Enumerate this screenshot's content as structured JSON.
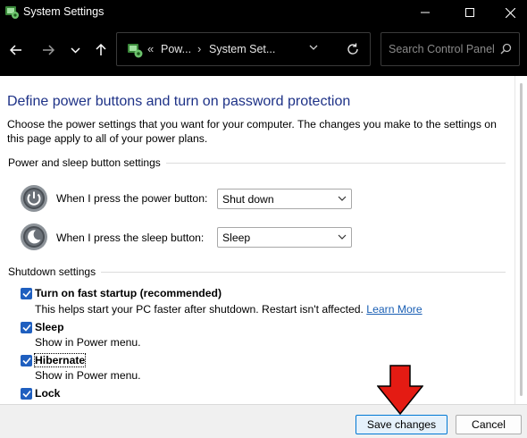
{
  "window": {
    "title": "System Settings",
    "controls": [
      "minimize-icon",
      "maximize-icon",
      "close-icon"
    ]
  },
  "nav": {
    "breadcrumb_overflow": "«",
    "breadcrumb": [
      "Pow...",
      "System Set..."
    ],
    "breadcrumb_separator": "›",
    "search_placeholder": "Search Control Panel"
  },
  "page": {
    "title": "Define power buttons and turn on password protection",
    "description": "Choose the power settings that you want for your computer. The changes you make to the settings on this page apply to all of your power plans."
  },
  "power_section": {
    "title": "Power and sleep button settings",
    "rows": [
      {
        "label": "When I press the power button:",
        "value": "Shut down",
        "icon": "power-icon"
      },
      {
        "label": "When I press the sleep button:",
        "value": "Sleep",
        "icon": "sleep-icon"
      }
    ]
  },
  "shutdown_section": {
    "title": "Shutdown settings",
    "items": [
      {
        "label": "Turn on fast startup (recommended)",
        "checked": true,
        "desc": "This helps start your PC faster after shutdown. Restart isn't affected.",
        "link": "Learn More"
      },
      {
        "label": "Sleep",
        "checked": true,
        "desc": "Show in Power menu."
      },
      {
        "label": "Hibernate",
        "checked": true,
        "desc": "Show in Power menu."
      },
      {
        "label": "Lock",
        "checked": true
      }
    ]
  },
  "footer": {
    "save_label": "Save changes",
    "cancel_label": "Cancel"
  },
  "colors": {
    "title_blue": "#1e3287",
    "checkbox_blue": "#1f5fbf",
    "link_blue": "#1a5fb4",
    "annotation_arrow": "#e41b13"
  }
}
